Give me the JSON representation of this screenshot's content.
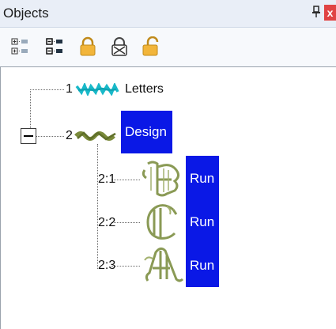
{
  "panel": {
    "title": "Objects",
    "pin_icon": "pin-icon",
    "close_icon": "close-icon",
    "close_label": "x"
  },
  "toolbar": {
    "icons": [
      "expand-all-icon",
      "collapse-all-icon",
      "lock-icon",
      "hide-icon",
      "unlock-icon"
    ]
  },
  "tree": {
    "items": [
      {
        "number": "1",
        "label": "Letters",
        "selected": false
      },
      {
        "number": "2",
        "label": "Design",
        "selected": true,
        "children": [
          {
            "number": "2:1",
            "label": "Run",
            "selected": true,
            "glyph": "B"
          },
          {
            "number": "2:2",
            "label": "Run",
            "selected": true,
            "glyph": "C"
          },
          {
            "number": "2:3",
            "label": "Run",
            "selected": true,
            "glyph": "A"
          }
        ]
      }
    ]
  },
  "colors": {
    "selection": "#0a18e6",
    "letters_thumbnail": "#19b9c9",
    "design_thumbnail": "#7a8a3a",
    "glyph_outline": "#8a9a55",
    "close_bg": "#e04343"
  }
}
